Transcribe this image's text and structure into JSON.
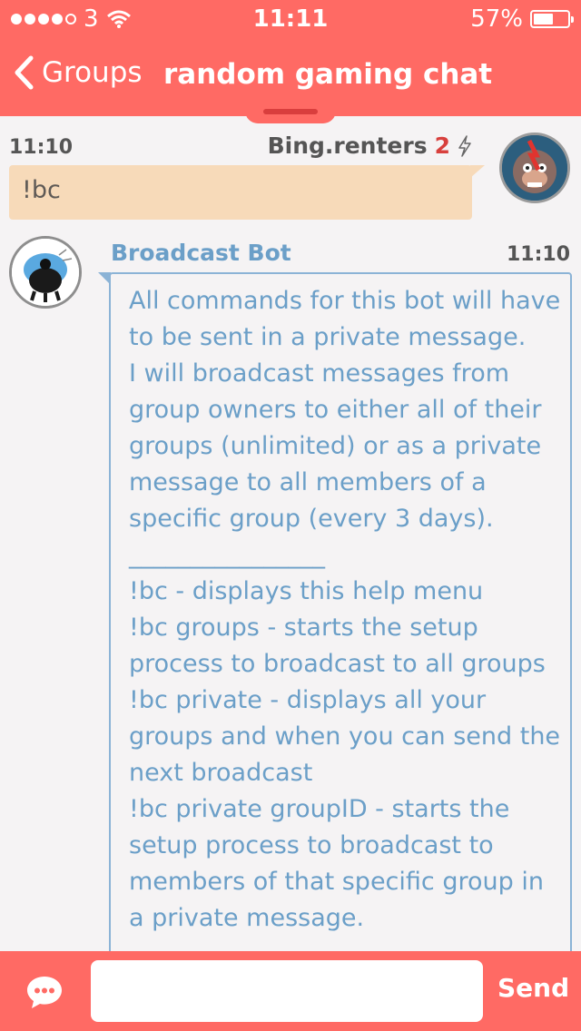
{
  "status_bar": {
    "carrier": "3",
    "signal_strength": 4,
    "signal_max": 5,
    "wifi_icon": "wifi-icon",
    "time": "11:11",
    "battery_percent": "57%",
    "battery_level": 0.57
  },
  "nav": {
    "back_icon": "chevron-left-icon",
    "back_label": "Groups",
    "title": "random gaming chat"
  },
  "messages": [
    {
      "time": "11:10",
      "sender": "Bing.renters",
      "badge_count": "2",
      "badge_icon": "lightning-icon",
      "text": "!bc"
    },
    {
      "time": "11:10",
      "sender": "Broadcast Bot",
      "text": "All commands for this bot will have to be sent in a private message.\nI will broadcast messages from group owners to either all of their groups (unlimited) or as a private message to all members of a specific group (every 3 days).\n________________\n!bc - displays this help menu\n!bc groups - starts the setup process to broadcast to all groups\n!bc private - displays all your groups and when you can send the next broadcast\n!bc private groupID - starts the setup process to broadcast to members of that specific group in a private message."
    }
  ],
  "composer": {
    "chat_icon": "chat-bubble-icon",
    "input_value": "",
    "input_placeholder": "",
    "send_label": "Send"
  },
  "colors": {
    "accent": "#ff6a64",
    "bot_text": "#6b9fc8",
    "own_bubble": "#f7dab9"
  }
}
